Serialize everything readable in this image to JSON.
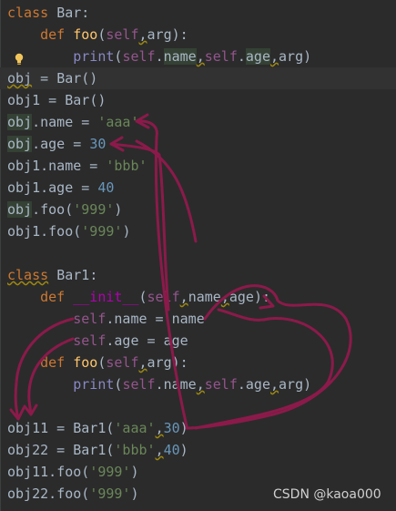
{
  "tokens": {
    "class": "class",
    "def": "def",
    "Bar": "Bar",
    "Bar1": "Bar1",
    "colon": ":",
    "foo": "foo",
    "init": "__init__",
    "self": "self",
    "arg": "arg",
    "name": "name",
    "age": "age",
    "print": "print",
    "obj": "obj",
    "obj1": "obj1",
    "obj11": "obj11",
    "obj22": "obj22",
    "aaa": "'aaa'",
    "bbb": "'bbb'",
    "s999": "'999'",
    "n30": "30",
    "n40": "40",
    "eq": " = ",
    "dot": ".",
    "comma": ",",
    "lp": "(",
    "rp": ")",
    "unit": "()",
    "indent4": "    ",
    "indent8": "        ",
    "space": " "
  },
  "watermark": "CSDN @kaoa000",
  "colors": {
    "background": "#2b2b2b",
    "keyword": "#cc7832",
    "function": "#ffc66d",
    "self": "#94558d",
    "string": "#6a8759",
    "number": "#6897bb",
    "arrow": "#8b1a4a"
  }
}
